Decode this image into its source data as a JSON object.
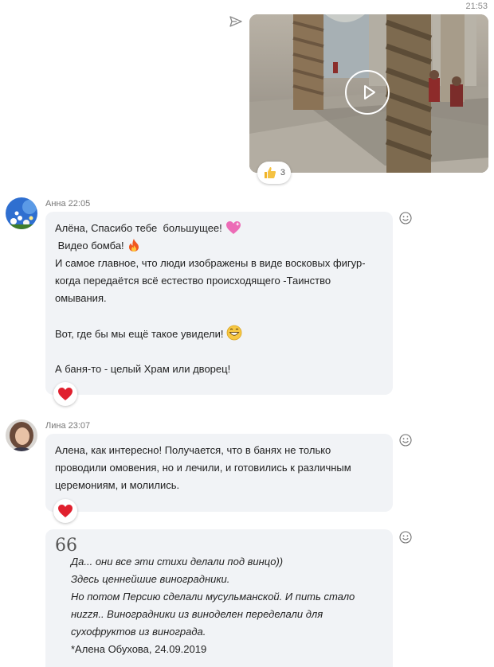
{
  "video_message": {
    "time": "21:53",
    "reaction": {
      "icon": "thumbs-up-icon",
      "count": "3"
    }
  },
  "messages": [
    {
      "sender": "Анна",
      "time": "22:05",
      "lines": [
        "Алёна, Спасибо тебе  большущее!",
        " Видео бомба!",
        "И самое главное, что люди изображены в виде восковых фигур-",
        "когда передаётся всё естество происходящего -Таинство",
        "омывания.",
        "",
        "Вот, где бы мы ещё такое увидели!",
        "",
        "А баня-то - целый Храм или дворец!"
      ],
      "reaction_icon": "heart-icon"
    },
    {
      "sender": "Лина",
      "time": "23:07",
      "lines": [
        "Алена, как интересно! Получается, что в банях не только",
        "проводили омовения, но и лечили, и готовились к различным",
        "церемониям, и молились."
      ],
      "reaction_icon": "heart-icon"
    },
    {
      "quote_mark": "66",
      "quote_lines": [
        "Да... они все эти стихи делали под винцо))",
        "Здесь ценнейшие виноградники.",
        "Но потом Персию сделали мусульманской. И пить стало",
        "ниzzя.. Виноградники из виноделен переделали для",
        "сухофруктов из винограда."
      ],
      "quote_author": "*Алена Обухова, 24.09.2019"
    }
  ],
  "colors": {
    "bubble": "#f1f3f6",
    "heart": "#e0202e",
    "meta_text": "#777777"
  }
}
